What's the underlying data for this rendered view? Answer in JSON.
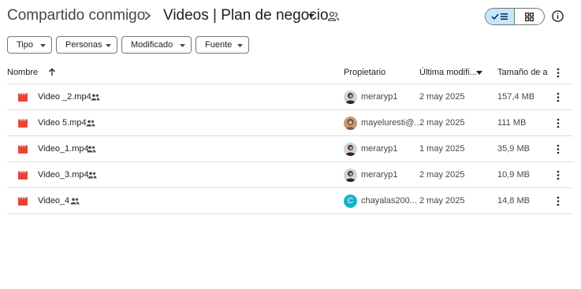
{
  "header": {
    "breadcrumb_root": "Compartido conmigo",
    "current_folder": "Videos | Plan de negocio"
  },
  "filters": [
    "Tipo",
    "Personas",
    "Modificado",
    "Fuente"
  ],
  "table": {
    "columns": {
      "name": "Nombre",
      "owner": "Propietario",
      "modified": "Última modifi...",
      "size": "Tamaño de a"
    },
    "rows": [
      {
        "name": "Video _2.mp4",
        "owner": "meraryp1",
        "modified": "2 may 2025",
        "size": "157,4 MB"
      },
      {
        "name": "Video 5.mp4",
        "owner": "mayeluresti@...",
        "modified": "2 may 2025",
        "size": "111 MB"
      },
      {
        "name": "Video_1.mp4",
        "owner": "meraryp1",
        "modified": "1 may 2025",
        "size": "35,9 MB"
      },
      {
        "name": "Video_3.mp4",
        "owner": "meraryp1",
        "modified": "2 may 2025",
        "size": "10,9 MB"
      },
      {
        "name": "Video_4",
        "owner": "chayalas200...",
        "modified": "2 may 2025",
        "size": "14,8 MB"
      }
    ],
    "avatar_letter": "C"
  },
  "colors": {
    "video_icon": "#ea4335",
    "view_toggle_active": "#c2e7ff",
    "avatar_teal": "#12b5cb"
  }
}
